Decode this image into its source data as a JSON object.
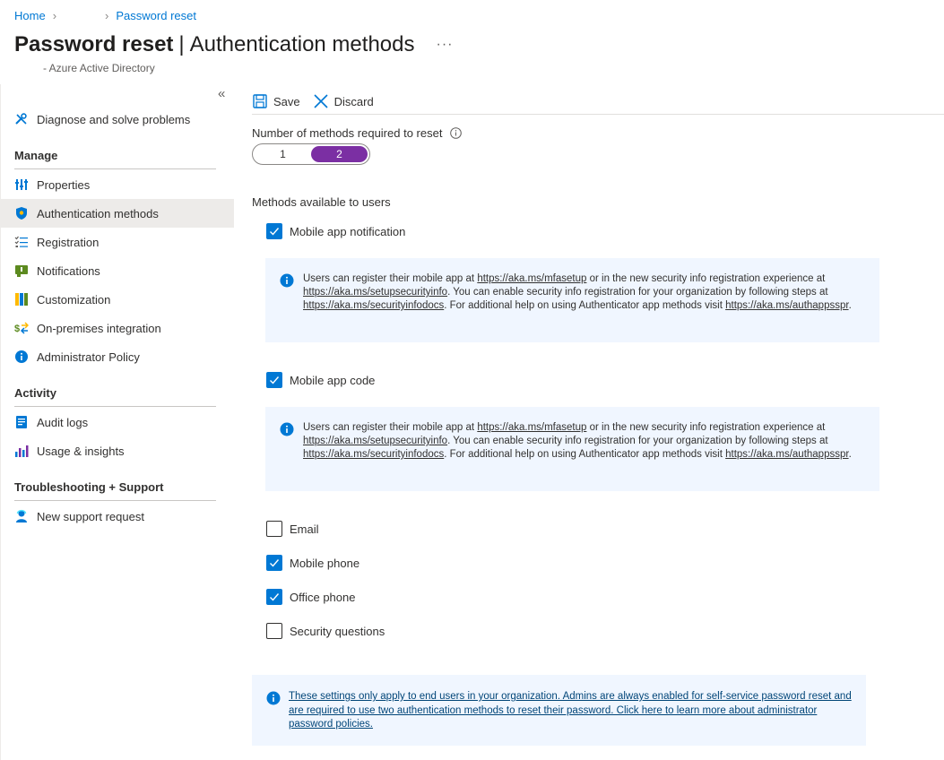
{
  "breadcrumb": {
    "home": "Home",
    "current": "Password reset"
  },
  "header": {
    "title": "Password reset",
    "section": "Authentication methods",
    "more": "···",
    "subtitle": "- Azure Active Directory"
  },
  "sidebar": {
    "collapse": "«",
    "top_item": "Diagnose and solve problems",
    "manage_heading": "Manage",
    "manage_items": [
      "Properties",
      "Authentication methods",
      "Registration",
      "Notifications",
      "Customization",
      "On-premises integration",
      "Administrator Policy"
    ],
    "activity_heading": "Activity",
    "activity_items": [
      "Audit logs",
      "Usage & insights"
    ],
    "support_heading": "Troubleshooting + Support",
    "support_items": [
      "New support request"
    ]
  },
  "toolbar": {
    "save": "Save",
    "discard": "Discard"
  },
  "methods_required": {
    "label": "Number of methods required to reset",
    "options": [
      "1",
      "2"
    ],
    "selected": "2"
  },
  "methods_available": {
    "label": "Methods available to users",
    "items": [
      {
        "label": "Mobile app notification",
        "checked": true
      },
      {
        "label": "Mobile app code",
        "checked": true
      },
      {
        "label": "Email",
        "checked": false
      },
      {
        "label": "Mobile phone",
        "checked": true
      },
      {
        "label": "Office phone",
        "checked": true
      },
      {
        "label": "Security questions",
        "checked": false
      }
    ]
  },
  "info": {
    "t1": "Users can register their mobile app at ",
    "l1": "https://aka.ms/mfasetup",
    "t2": " or in the new security info registration experience at ",
    "l2": "https://aka.ms/setupsecurityinfo",
    "t3": ". You can enable security info registration for your organization by following steps at ",
    "l3": "https://aka.ms/securityinfodocs",
    "t4": ". For additional help on using Authenticator app methods visit ",
    "l4": "https://aka.ms/authappsspr",
    "t5": "."
  },
  "bottom_note": "These settings only apply to end users in your organization. Admins are always enabled for self-service password reset and are required to use two authentication methods to reset their password. Click here to learn more about administrator password policies.",
  "colors": {
    "accent": "#0078d4",
    "toggle_selected": "#7b2fa3",
    "info_bg": "#f0f6ff"
  }
}
